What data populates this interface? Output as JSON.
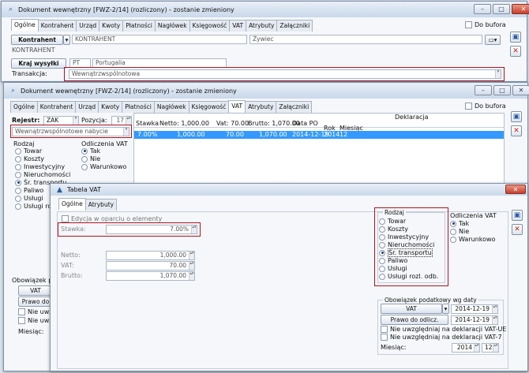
{
  "window1": {
    "title": "Dokument wewnętrzny [FWZ-2/14] (rozliczony) - zostanie zmieniony",
    "tabs": [
      "Ogólne",
      "Kontrahent",
      "Urząd",
      "Kwoty",
      "Płatności",
      "Nagłówek",
      "Księgowość",
      "VAT",
      "Atrybuty",
      "Załączniki"
    ],
    "do_bufora": "Do bufora",
    "kontrahent_label": "Kontrahent",
    "kontrahent_code": "KONTRAHENT",
    "kontrahent_city": "Żywiec",
    "kontrahent_name": "KONTRAHENT",
    "kraj_label": "Kraj wysyłki",
    "kraj_code": "PT",
    "kraj_name": "Portugalia",
    "transakcja_label": "Transakcja:",
    "transakcja_value": "Wewnątrzwspólnotowa"
  },
  "window2": {
    "title": "Dokument wewnętrzny [FWZ-2/14] (rozliczony) - zostanie zmieniony",
    "tabs": [
      "Ogólne",
      "Kontrahent",
      "Urząd",
      "Kwoty",
      "Płatności",
      "Nagłówek",
      "Księgowość",
      "VAT",
      "Atrybuty",
      "Załączniki"
    ],
    "do_bufora": "Do bufora",
    "rejestr_label": "Rejestr:",
    "rejestr_value": "ZAK",
    "pozycja_label": "Pozycja:",
    "pozycja_value": "17",
    "nabycie_value": "Wewnątrzwspólnotowe nabycie",
    "rodzaj_label": "Rodzaj",
    "rodzaj_items": [
      "Towar",
      "Koszty",
      "Inwestycyjny",
      "Nieruchomości",
      "Śr. transportu",
      "Paliwo",
      "Usługi",
      "Usługi roz"
    ],
    "odliczenia_label": "Odliczenia VAT",
    "odliczenia_items": [
      "Tak",
      "Nie",
      "Warunkowo"
    ],
    "table_headers": [
      "Stawka",
      "Netto: 1,000.00",
      "Vat: 70.00",
      "Brutto: 1,070.00",
      "Data PO",
      "Rok",
      "Miesiąc"
    ],
    "deklaracja_header": "Deklaracja",
    "row": [
      "7.00%",
      "1,000.00",
      "70.00",
      "1,070.00",
      "2014-12-19",
      "2014",
      "12"
    ],
    "obowiazek_label": "Obowiązek p",
    "vat_btn": "VAT",
    "prawo_btn": "Prawo do",
    "nie_uwzg1": "Nie uwzgl",
    "nie_uwzg2": "Nie uwzgl",
    "miesiac_label": "Miesiąc:"
  },
  "dialog": {
    "title": "Tabela VAT",
    "tabs": [
      "Ogólne",
      "Atrybuty"
    ],
    "edycja_label": "Edycja w oparciu o elementy",
    "stawka_label": "Stawka:",
    "stawka_value": "7.00%",
    "netto_label": "Netto:",
    "netto_value": "1,000.00",
    "vat_label": "VAT:",
    "vat_value": "70.00",
    "brutto_label": "Brutto:",
    "brutto_value": "1,070.00",
    "rodzaj_label": "Rodzaj",
    "rodzaj_items": [
      "Towar",
      "Koszty",
      "Inwestycyjny",
      "Nieruchomości",
      "Śr. transportu",
      "Paliwo",
      "Usługi",
      "Usługi rozl. odb."
    ],
    "odliczenia_label": "Odliczenia VAT",
    "odliczenia_items": [
      "Tak",
      "Nie",
      "Warunkowo"
    ],
    "obowiazek_label": "Obowiązek podatkowy wg daty",
    "vat_btn": "VAT",
    "vat_date": "2014-12-19",
    "prawo_btn": "Prawo do odlicz.",
    "prawo_date": "2014-12-19",
    "nie_uwzg_ue": "Nie uwzględniaj na deklaracji VAT-UE",
    "nie_uwzg_7": "Nie uwzględniaj na deklaracji VAT-7",
    "miesiac_label": "Miesiąc:",
    "rok_value": "2014",
    "miesiac_value": "12"
  },
  "colors": {
    "highlight_red": "#b01420",
    "row_selected": "#3399ff"
  }
}
